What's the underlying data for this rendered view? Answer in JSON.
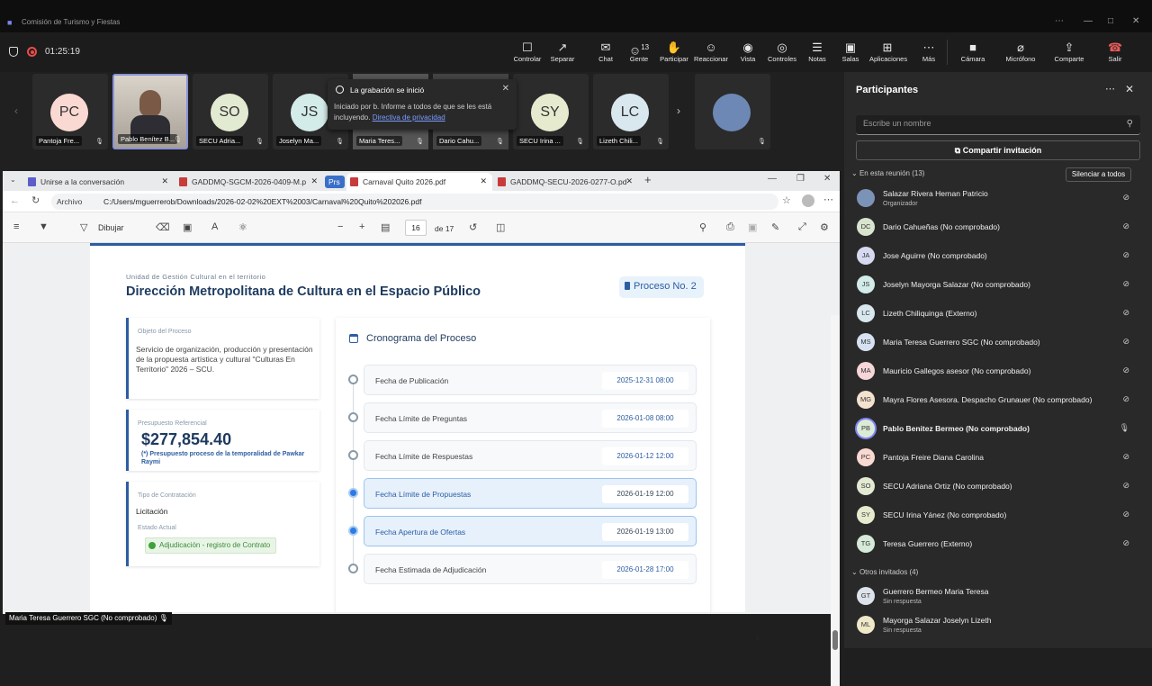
{
  "window": {
    "title": "Comisión de Turismo y Fiestas"
  },
  "meeting": {
    "elapsed": "01:25:19",
    "toolbar": [
      {
        "label": "Controlar",
        "icon": "control-icon"
      },
      {
        "label": "Separar",
        "icon": "popout-icon"
      },
      {
        "label": "Chat",
        "icon": "chat-icon"
      },
      {
        "label": "Gente",
        "icon": "people-icon",
        "count": "13"
      },
      {
        "label": "Participar",
        "icon": "raise-hand-icon"
      },
      {
        "label": "Reaccionar",
        "icon": "react-icon"
      },
      {
        "label": "Vista",
        "icon": "view-icon"
      },
      {
        "label": "Controles",
        "icon": "controls-icon"
      },
      {
        "label": "Notas",
        "icon": "notes-icon"
      },
      {
        "label": "Salas",
        "icon": "rooms-icon"
      },
      {
        "label": "Aplicaciones",
        "icon": "apps-icon"
      },
      {
        "label": "Más",
        "icon": "more-icon"
      }
    ],
    "camera": "Cámara",
    "microphone": "Micrófono",
    "share": "Comparte",
    "leave": "Salir"
  },
  "video_tiles": [
    {
      "initials": "PC",
      "name": "Pantoja Fre...",
      "color": "#fbd9d3"
    },
    {
      "initials": "",
      "name": "Pablo Benítez B...",
      "color": "#a99c8f",
      "video": true
    },
    {
      "initials": "SO",
      "name": "SECU Adria...",
      "color": "#e3ead2"
    },
    {
      "initials": "JS",
      "name": "Joselyn Ma...",
      "color": "#d4ece9"
    },
    {
      "initials": "",
      "name": "Maria Teres...",
      "color": "#555"
    },
    {
      "initials": "",
      "name": "Dario Cahu...",
      "color": "#444"
    },
    {
      "initials": "SY",
      "name": "SECU Irina ...",
      "color": "#e6ebcf"
    },
    {
      "initials": "LC",
      "name": "Lizeth Chili...",
      "color": "#d9e8ef"
    },
    {
      "initials": "",
      "name": "",
      "color": "#6d88b5",
      "photo": true
    }
  ],
  "toast": {
    "title": "La grabación se inició",
    "body": "Iniciado por b. Informe a todos de que se les está incluyendo.",
    "link": "Directiva de privacidad"
  },
  "browser": {
    "tabs": [
      {
        "label": "Unirse a la conversación",
        "color": "#5b5fc7"
      },
      {
        "label": "GADDMQ-SGCM-2026-0409-M.p",
        "color": "#c73b3b"
      },
      {
        "label": "Prs",
        "color": "#3a6fc8"
      },
      {
        "label": "Carnaval Quito 2026.pdf",
        "color": "#c73b3b",
        "active": true
      },
      {
        "label": "GADDMQ-SECU-2026-0277-O.pd",
        "color": "#c73b3b"
      }
    ],
    "address_label": "Archivo",
    "url": "C:/Users/mguerrerob/Downloads/2026-02-02%20EXT%2003/Carnaval%20Quito%202026.pdf",
    "pdf": {
      "draw_label": "Dibujar",
      "page": "16",
      "of": "de 17"
    }
  },
  "doc": {
    "tagline": "Unidad de Gestión Cultural en el territorio",
    "title": "Dirección Metropolitana de Cultura en el Espacio Público",
    "process": "Proceso No. 2",
    "object_label": "Objeto del Proceso",
    "object_text": "Servicio de organización, producción y presentación de la propuesta artística y cultural \"Culturas En Territorio\" 2026 – SCU.",
    "budget_label": "Presupuesto Referencial",
    "budget": "$277,854.40",
    "budget_note": "(*) Presupuesto proceso de la temporalidad de Pawkar Raymi",
    "contract_label": "Tipo de Contratación",
    "contract": "Licitación",
    "state_label": "Estado Actual",
    "state": "Adjudicación - registro de Contrato",
    "schedule_title": "Cronograma del Proceso",
    "schedule": [
      {
        "label": "Fecha de Publicación",
        "date": "2025-12-31 08:00",
        "active": false
      },
      {
        "label": "Fecha Límite de Preguntas",
        "date": "2026-01-08 08:00",
        "active": false
      },
      {
        "label": "Fecha Límite de Respuestas",
        "date": "2026-01-12 12:00",
        "active": false
      },
      {
        "label": "Fecha Límite de Propuestas",
        "date": "2026-01-19 12:00",
        "active": true
      },
      {
        "label": "Fecha Apertura de Ofertas",
        "date": "2026-01-19 13:00",
        "active": true
      },
      {
        "label": "Fecha Estimada de Adjudicación",
        "date": "2026-01-28 17:00",
        "active": false
      }
    ]
  },
  "bottom_name": "Maria Teresa Guerrero SGC (No comprobado)",
  "panel": {
    "title": "Participantes",
    "search_placeholder": "Escribe un nombre",
    "share": "Compartir invitación",
    "in_meeting": "En esta reunión (13)",
    "mute_all": "Silenciar a todos",
    "participants": [
      {
        "initials": "",
        "name": "Salazar Rivera Hernan Patricio",
        "sub": "Organizador",
        "color": "#7c93b8",
        "photo": true
      },
      {
        "initials": "DC",
        "name": "Dario Cahueñas (No comprobado)",
        "color": "#d9e4cf"
      },
      {
        "initials": "JA",
        "name": "Jose Aguirre (No comprobado)",
        "color": "#d6d9f0"
      },
      {
        "initials": "JS",
        "name": "Joselyn Mayorga Salazar (No comprobado)",
        "color": "#d4ece9"
      },
      {
        "initials": "LC",
        "name": "Lizeth Chiliquinga (Externo)",
        "color": "#d9e8ef"
      },
      {
        "initials": "MS",
        "name": "Maria Teresa Guerrero SGC (No comprobado)",
        "color": "#d6e2f2"
      },
      {
        "initials": "MA",
        "name": "Mauricio Gallegos asesor (No comprobado)",
        "color": "#f6d6d8"
      },
      {
        "initials": "MG",
        "name": "Mayra Flores Asesora. Despacho Grunauer (No comprobado)",
        "color": "#f3e2cd"
      },
      {
        "initials": "PB",
        "name": "Pablo Benitez Bermeo (No comprobado)",
        "color": "#dcebd5",
        "bold": true,
        "speaking": true
      },
      {
        "initials": "PC",
        "name": "Pantoja Freire Diana Carolina",
        "color": "#fbd9d3"
      },
      {
        "initials": "SO",
        "name": "SECU Adriana Ortiz (No comprobado)",
        "color": "#e3ead2"
      },
      {
        "initials": "SY",
        "name": "SECU Irina Yánez (No comprobado)",
        "color": "#e6ebcf"
      },
      {
        "initials": "TG",
        "name": "Teresa Guerrero (Externo)",
        "color": "#d5ead9"
      }
    ],
    "others": "Otros invitados (4)",
    "invited": [
      {
        "initials": "GT",
        "name": "Guerrero Bermeo Maria Teresa",
        "sub": "Sin respuesta",
        "color": "#dde3ea"
      },
      {
        "initials": "ML",
        "name": "Mayorga Salazar Joselyn Lizeth",
        "sub": "Sin respuesta",
        "color": "#efe8c9"
      }
    ]
  }
}
